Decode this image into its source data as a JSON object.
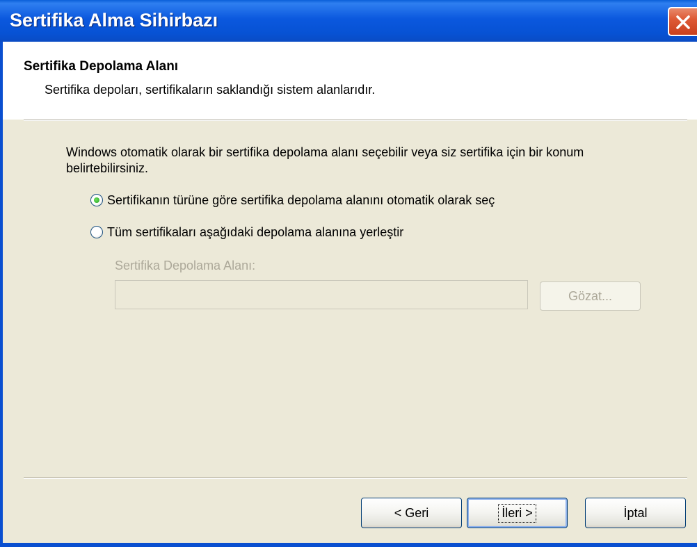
{
  "window": {
    "title": "Sertifika Alma Sihirbazı"
  },
  "header": {
    "title": "Sertifika Depolama Alanı",
    "description": "Sertifika depoları, sertifikaların saklandığı sistem alanlarıdır."
  },
  "body": {
    "intro": "Windows otomatik olarak bir sertifika depolama alanı seçebilir veya siz sertifika için bir konum belirtebilirsiniz.",
    "options": [
      {
        "label": "Sertifikanın türüne göre sertifika depolama alanını otomatik olarak seç",
        "selected": true
      },
      {
        "label": "Tüm sertifikaları aşağıdaki depolama alanına yerleştir",
        "selected": false
      }
    ],
    "store_label": "Sertifika Depolama Alanı:",
    "store_value": "",
    "browse_label": "Gözat..."
  },
  "footer": {
    "back_label": "< Geri",
    "next_label": "İleri >",
    "cancel_label": "İptal"
  },
  "colors": {
    "titlebar": "#0752d4",
    "dialog_bg": "#ece9d8",
    "close_button": "#de5a36",
    "radio_selected": "#21a121",
    "disabled_text": "#aca899"
  },
  "icons": {
    "close": "close-icon"
  }
}
